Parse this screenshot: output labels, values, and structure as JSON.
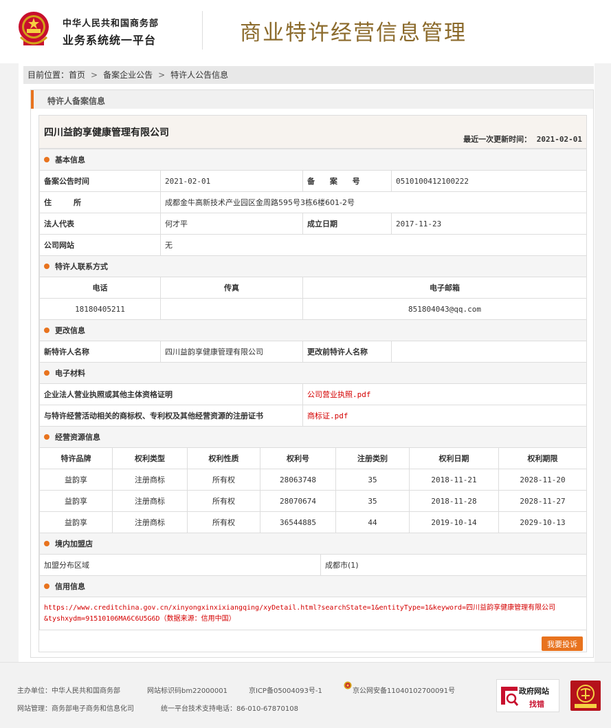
{
  "header": {
    "org_line1": "中华人民共和国商务部",
    "org_line2": "业务系统统一平台",
    "site_title": "商业特许经营信息管理"
  },
  "breadcrumb": {
    "prefix": "目前位置：",
    "items": [
      "首页",
      "备案企业公告",
      "特许人公告信息"
    ],
    "separator": ">"
  },
  "panel": {
    "title": "特许人备案信息",
    "company_name": "四川益韵享健康管理有限公司",
    "last_update_label": "最近一次更新时间：",
    "last_update_value": "2021-02-01"
  },
  "basic": {
    "section": "基本信息",
    "notice_time_label": "备案公告时间",
    "notice_time_value": "2021-02-01",
    "record_no_label": "备 案 号",
    "record_no_value": "0510100412100222",
    "address_label": "住所",
    "address_value": "成都金牛高新技术产业园区金周路595号3栋6楼601-2号",
    "legal_rep_label": "法人代表",
    "legal_rep_value": "何才平",
    "founded_label": "成立日期",
    "founded_value": "2017-11-23",
    "website_label": "公司网站",
    "website_value": "无"
  },
  "contact": {
    "section": "特许人联系方式",
    "phone_label": "电话",
    "fax_label": "传真",
    "email_label": "电子邮箱",
    "phone_value": "18180405211",
    "fax_value": "",
    "email_value": "851804043@qq.com"
  },
  "change": {
    "section": "更改信息",
    "new_name_label": "新特许人名称",
    "new_name_value": "四川益韵享健康管理有限公司",
    "old_name_label": "更改前特许人名称",
    "old_name_value": ""
  },
  "materials": {
    "section": "电子材料",
    "items": [
      {
        "label": "企业法人营业执照或其他主体资格证明",
        "file": "公司营业执照.pdf"
      },
      {
        "label": "与特许经营活动相关的商标权、专利权及其他经营资源的注册证书",
        "file": "商标证.pdf"
      }
    ]
  },
  "resources": {
    "section": "经营资源信息",
    "headers": [
      "特许品牌",
      "权利类型",
      "权利性质",
      "权利号",
      "注册类别",
      "权利日期",
      "权利期限"
    ],
    "rows": [
      [
        "益韵享",
        "注册商标",
        "所有权",
        "28063748",
        "35",
        "2018-11-21",
        "2028-11-20"
      ],
      [
        "益韵享",
        "注册商标",
        "所有权",
        "28070674",
        "35",
        "2018-11-28",
        "2028-11-27"
      ],
      [
        "益韵享",
        "注册商标",
        "所有权",
        "36544885",
        "44",
        "2019-10-14",
        "2029-10-13"
      ]
    ]
  },
  "stores": {
    "section": "境内加盟店",
    "region_label": "加盟分布区域",
    "region_value": "成都市(1)"
  },
  "credit": {
    "section": "信用信息",
    "line1": "https://www.creditchina.gov.cn/xinyongxinxixiangqing/xyDetail.html?searchState=1&entityType=1&keyword=四川益韵享健康管理有限公司",
    "line2": "&tyshxydm=91510106MA6C6U5G6D（数据来源：信用中国）"
  },
  "complain_button": "我要投诉",
  "footer": {
    "host": "主办单位：中华人民共和国商务部",
    "site_code": "网站标识码bm22000001",
    "icp": "京ICP备05004093号-1",
    "police": "京公网安备11040102700091号",
    "manager": "网站管理：商务部电子商务和信息化司",
    "support": "统一平台技术支持电话：86-010-67870108",
    "gov_badge_line1": "政府网站",
    "gov_badge_line2": "找错"
  },
  "colors": {
    "accent": "#e8731e",
    "title_gold": "#8b6a2b",
    "link_red": "#d40000"
  }
}
